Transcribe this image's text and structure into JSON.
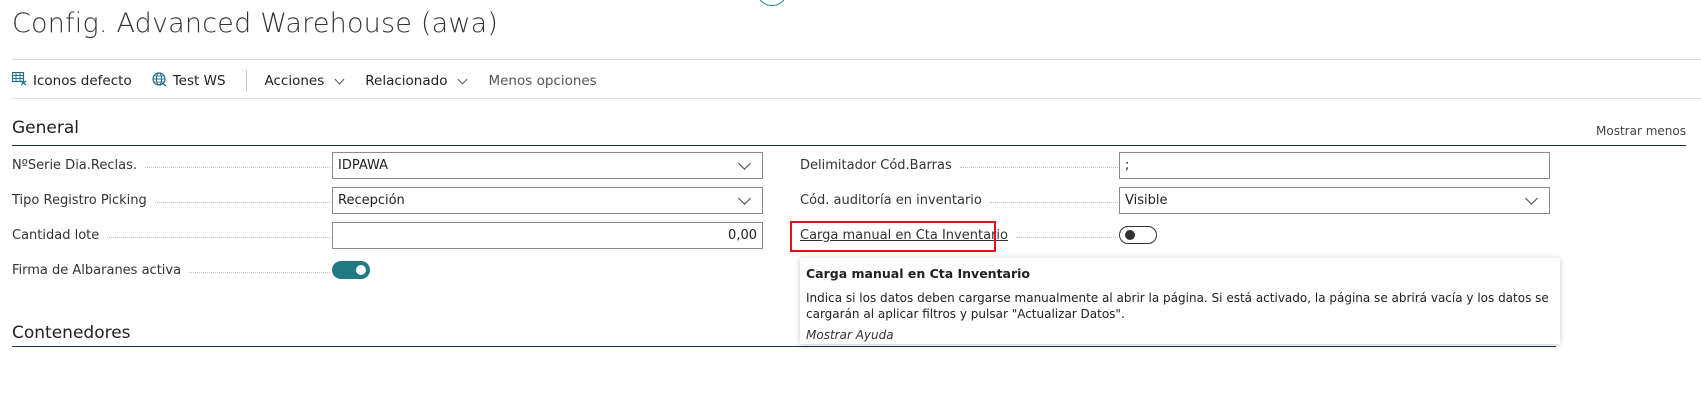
{
  "page": {
    "title": "Config. Advanced Warehouse (awa)"
  },
  "toolbar": {
    "items": [
      {
        "label": "Iconos defecto",
        "icon": "grid-table-icon"
      },
      {
        "label": "Test WS",
        "icon": "globe-icon"
      }
    ],
    "actions_label": "Acciones",
    "related_label": "Relacionado",
    "less_options_label": "Menos opciones"
  },
  "sections": {
    "general_title": "General",
    "show_less_label": "Mostrar menos",
    "containers_title": "Contenedores"
  },
  "fields": {
    "serie_dia_reclas": {
      "label": "NºSerie Dia.Reclas.",
      "value": "IDPAWA"
    },
    "tipo_registro_picking": {
      "label": "Tipo Registro Picking",
      "value": "Recepción"
    },
    "cantidad_lote": {
      "label": "Cantidad lote",
      "value": "0,00"
    },
    "firma_albaranes": {
      "label": "Firma de Albaranes activa",
      "value": true
    },
    "delimitador_cod_barras": {
      "label": "Delimitador Cód.Barras",
      "value": ";"
    },
    "cod_auditoria": {
      "label": "Cód. auditoría en inventario",
      "value": "Visible"
    },
    "carga_manual": {
      "label": "Carga manual en Cta Inventario",
      "value": false
    }
  },
  "tooltip": {
    "title": "Carga manual en Cta Inventario",
    "body": "Indica si los datos deben cargarse manualmente al abrir la página. Si está activado, la página se abrirá vacía y los datos se cargarán al aplicar filtros y pulsar \"Actualizar Datos\".",
    "help_link": "Mostrar Ayuda"
  },
  "colors": {
    "accent": "#1f7a84",
    "highlight": "#e0121b",
    "section_line": "#1c2a4a"
  }
}
